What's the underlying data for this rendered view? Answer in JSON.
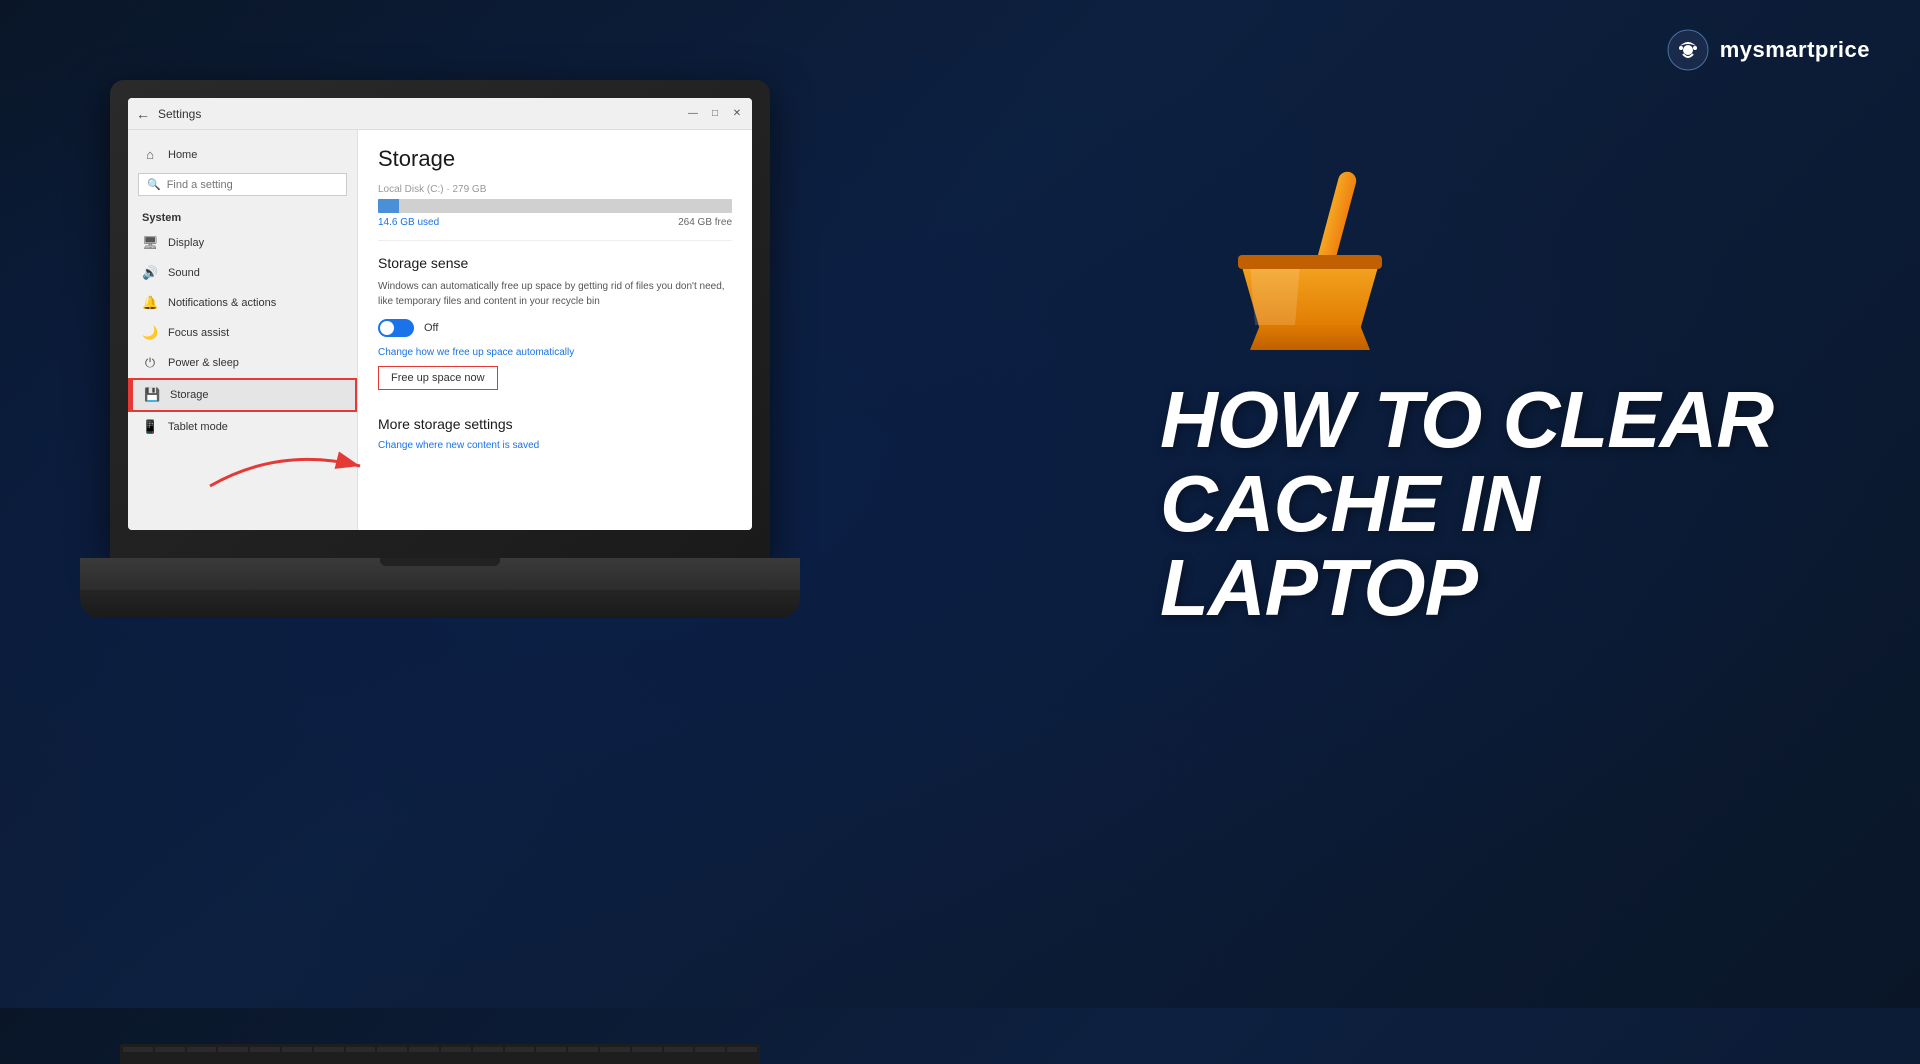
{
  "brand": {
    "name": "mysmartprice",
    "logo_alt": "mysmartprice logo"
  },
  "titlebar": {
    "title": "Settings",
    "back_label": "←",
    "minimize": "—",
    "maximize": "□",
    "close": "✕"
  },
  "sidebar": {
    "search_placeholder": "Find a setting",
    "section_label": "System",
    "items": [
      {
        "id": "home",
        "label": "Home",
        "icon": "⌂"
      },
      {
        "id": "display",
        "label": "Display",
        "icon": "🖥"
      },
      {
        "id": "sound",
        "label": "Sound",
        "icon": "🔊"
      },
      {
        "id": "notifications",
        "label": "Notifications & actions",
        "icon": "🔔"
      },
      {
        "id": "focus",
        "label": "Focus assist",
        "icon": "🌙"
      },
      {
        "id": "power",
        "label": "Power & sleep",
        "icon": "⏻"
      },
      {
        "id": "storage",
        "label": "Storage",
        "icon": "💾",
        "active": true
      },
      {
        "id": "tablet",
        "label": "Tablet mode",
        "icon": "📱"
      }
    ]
  },
  "main": {
    "page_title": "Storage",
    "disk": {
      "label": "Local Disk (C:) · 279 GB",
      "used_label": "14.6 GB used",
      "free_label": "264 GB free",
      "used_percent": 6
    },
    "storage_sense": {
      "title": "Storage sense",
      "description": "Windows can automatically free up space by getting rid of files you don't need, like temporary files and content in your recycle bin",
      "toggle_state": "Off",
      "toggle_on": false,
      "change_link": "Change how we free up space automatically",
      "free_btn": "Free up space now"
    },
    "more_storage": {
      "title": "More storage settings",
      "change_link": "Change where new content is saved"
    }
  },
  "headline": {
    "line1": "HOW TO CLEAR",
    "line2": "CACHE IN LAPTOP"
  }
}
